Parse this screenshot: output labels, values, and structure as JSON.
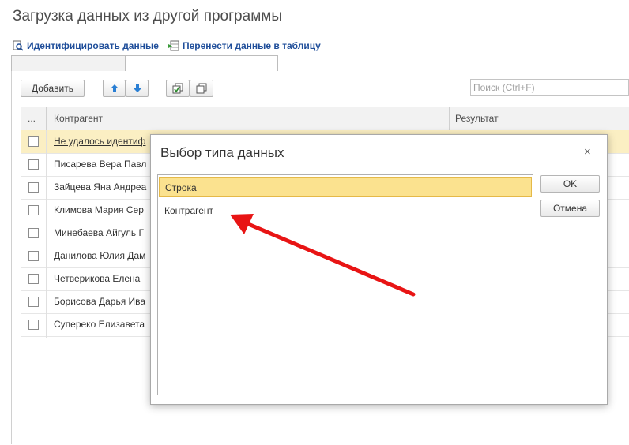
{
  "window": {
    "title": "Загрузка данных из другой программы"
  },
  "commands": {
    "identify": "Идентифицировать данные",
    "transfer": "Перенести данные в таблицу"
  },
  "toolbar": {
    "add": "Добавить",
    "search_placeholder": "Поиск (Ctrl+F)"
  },
  "table": {
    "columns": [
      "...",
      "Контрагент",
      "Результат"
    ],
    "rows": [
      "Не удалось идентиф",
      "Писарева Вера Павл",
      "Зайцева Яна Андреа",
      "Климова Мария Сер",
      "Минебаева Айгуль Г",
      "Данилова Юлия Дам",
      "Четверикова Елена",
      "Борисова Дарья Ива",
      "Супереко Елизавета"
    ]
  },
  "dialog": {
    "title": "Выбор типа данных",
    "close": "×",
    "items": [
      "Строка",
      "Контрагент"
    ],
    "ok": "OK",
    "cancel": "Отмена"
  },
  "colors": {
    "selection": "#fbe28f",
    "accent_link": "#1f4e9a",
    "arrow": "#e81414"
  }
}
